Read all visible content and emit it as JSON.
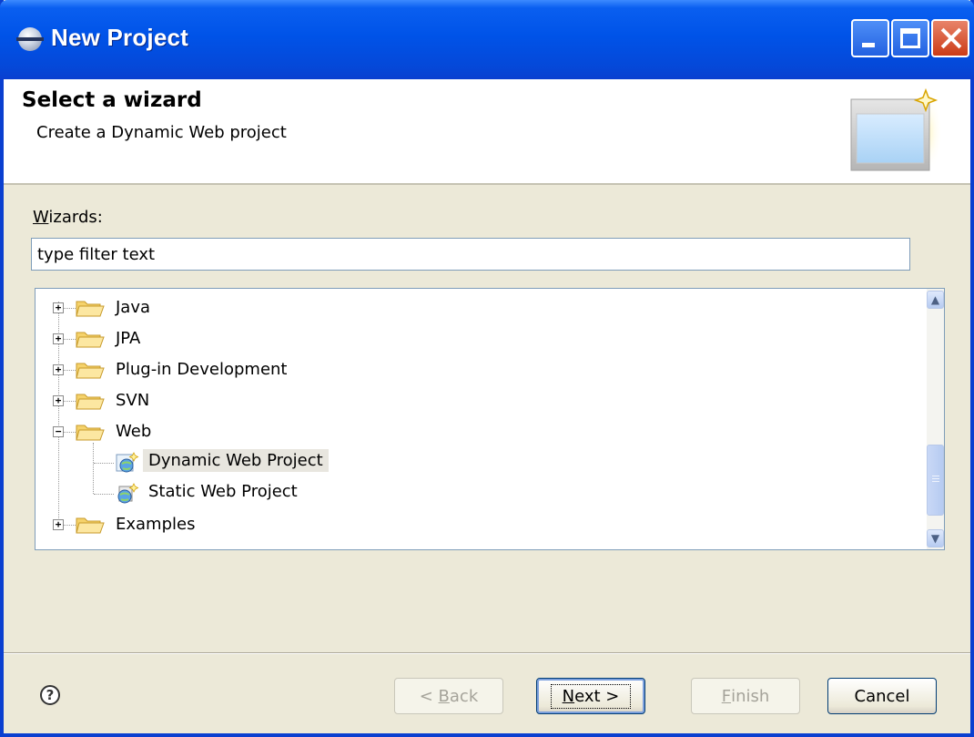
{
  "window": {
    "title": "New Project"
  },
  "header": {
    "title": "Select a wizard",
    "description": "Create a Dynamic Web project"
  },
  "wizards": {
    "label_mnemonic": "W",
    "label_rest": "izards:",
    "filter_value": "type filter text"
  },
  "tree": {
    "items": [
      {
        "label": "Java",
        "expanded": false,
        "icon": "folder-icon"
      },
      {
        "label": "JPA",
        "expanded": false,
        "icon": "folder-icon"
      },
      {
        "label": "Plug-in Development",
        "expanded": false,
        "icon": "folder-icon"
      },
      {
        "label": "SVN",
        "expanded": false,
        "icon": "folder-icon"
      },
      {
        "label": "Web",
        "expanded": true,
        "icon": "folder-icon",
        "children": [
          {
            "label": "Dynamic Web Project",
            "selected": true,
            "icon": "dynamic-web-project-icon"
          },
          {
            "label": "Static Web Project",
            "selected": false,
            "icon": "static-web-project-icon"
          }
        ]
      },
      {
        "label": "Examples",
        "expanded": false,
        "icon": "folder-icon"
      }
    ]
  },
  "buttons": {
    "back": {
      "prefix": "< ",
      "mnemonic": "B",
      "rest": "ack",
      "enabled": false
    },
    "next": {
      "mnemonic": "N",
      "rest": "ext >",
      "enabled": true
    },
    "finish": {
      "mnemonic": "F",
      "rest": "inish",
      "enabled": false
    },
    "cancel": {
      "label": "Cancel",
      "enabled": true
    }
  },
  "help": {
    "glyph": "?"
  },
  "colors": {
    "titlebar": "#0053e8",
    "dialog_bg": "#ece9d8",
    "folder": "#f5d26b"
  }
}
